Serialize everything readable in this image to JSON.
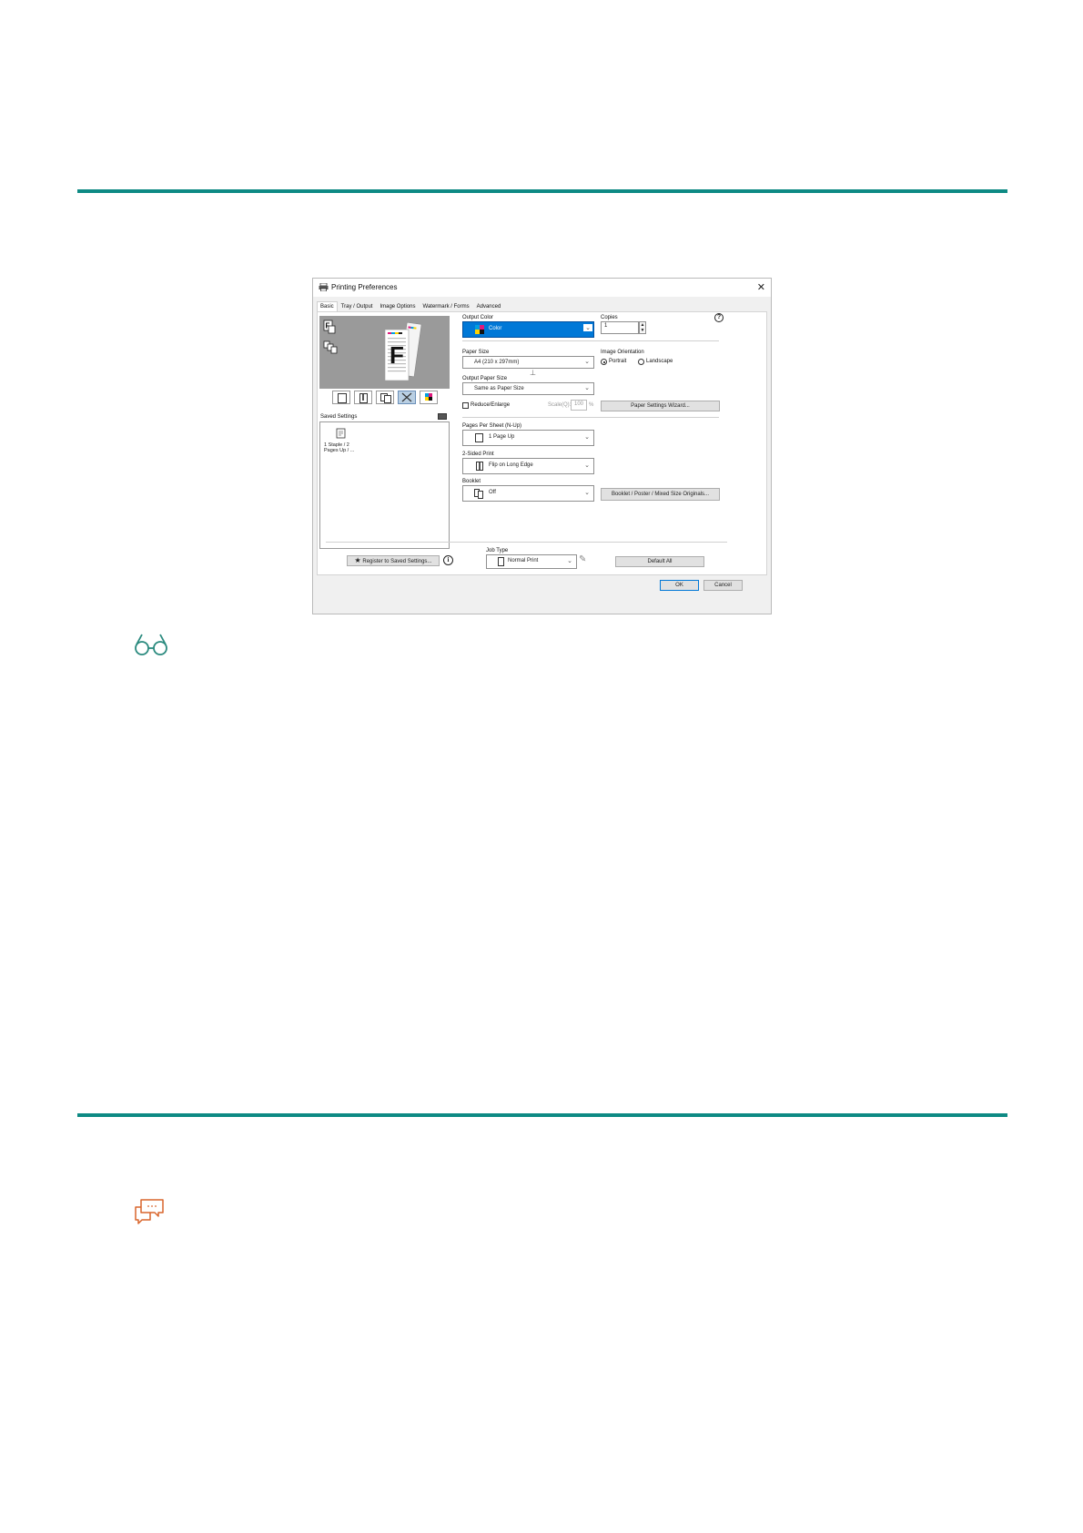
{
  "dialog": {
    "title": "Printing Preferences",
    "close_glyph": "✕",
    "tabs": [
      {
        "label": "Basic",
        "active": true
      },
      {
        "label": "Tray / Output",
        "active": false
      },
      {
        "label": "Image Options",
        "active": false
      },
      {
        "label": "Watermark / Forms",
        "active": false
      },
      {
        "label": "Advanced",
        "active": false
      }
    ],
    "help_glyph": "?",
    "preview": {
      "letter": "F"
    },
    "saved_settings": {
      "label": "Saved Settings",
      "items": [
        {
          "text": "1 Staple / 2\nPages Up / ..."
        }
      ]
    },
    "output_color": {
      "label": "Output Color",
      "value": "Color"
    },
    "copies": {
      "label": "Copies",
      "value": "1"
    },
    "paper_size": {
      "label": "Paper Size",
      "value": "A4 (210 x 297mm)"
    },
    "image_orientation": {
      "label": "Image Orientation",
      "options": [
        {
          "label": "Portrait",
          "selected": true
        },
        {
          "label": "Landscape",
          "selected": false
        }
      ]
    },
    "output_paper_size": {
      "label": "Output Paper Size",
      "value": "Same as Paper Size"
    },
    "reduce_enlarge": {
      "label": "Reduce/Enlarge",
      "checked": false
    },
    "scale": {
      "label": "Scale(Q):",
      "value": "100",
      "unit": "%"
    },
    "paper_settings_wizard": {
      "label": "Paper Settings Wizard..."
    },
    "pages_per_sheet": {
      "label": "Pages Per Sheet (N-Up)",
      "value": "1 Page Up"
    },
    "two_sided": {
      "label": "2-Sided Print",
      "value": "Flip on Long Edge"
    },
    "booklet": {
      "label": "Booklet",
      "value": "Off"
    },
    "booklet_button": {
      "label": "Booklet / Poster / Mixed Size Originals..."
    },
    "register_button": {
      "label": "Register to Saved Settings..."
    },
    "info_glyph": "i",
    "job_type": {
      "label": "Job Type",
      "value": "Normal Print"
    },
    "default_all": {
      "label": "Default All"
    },
    "ok": {
      "label": "OK"
    },
    "cancel": {
      "label": "Cancel"
    }
  },
  "colors": {
    "rule": "#0e8a84",
    "selection": "#0078d7",
    "glasses_icon": "#2a8a7e",
    "comment_icon": "#d9652b"
  },
  "icons": [
    "glasses-icon",
    "comment-icon"
  ]
}
